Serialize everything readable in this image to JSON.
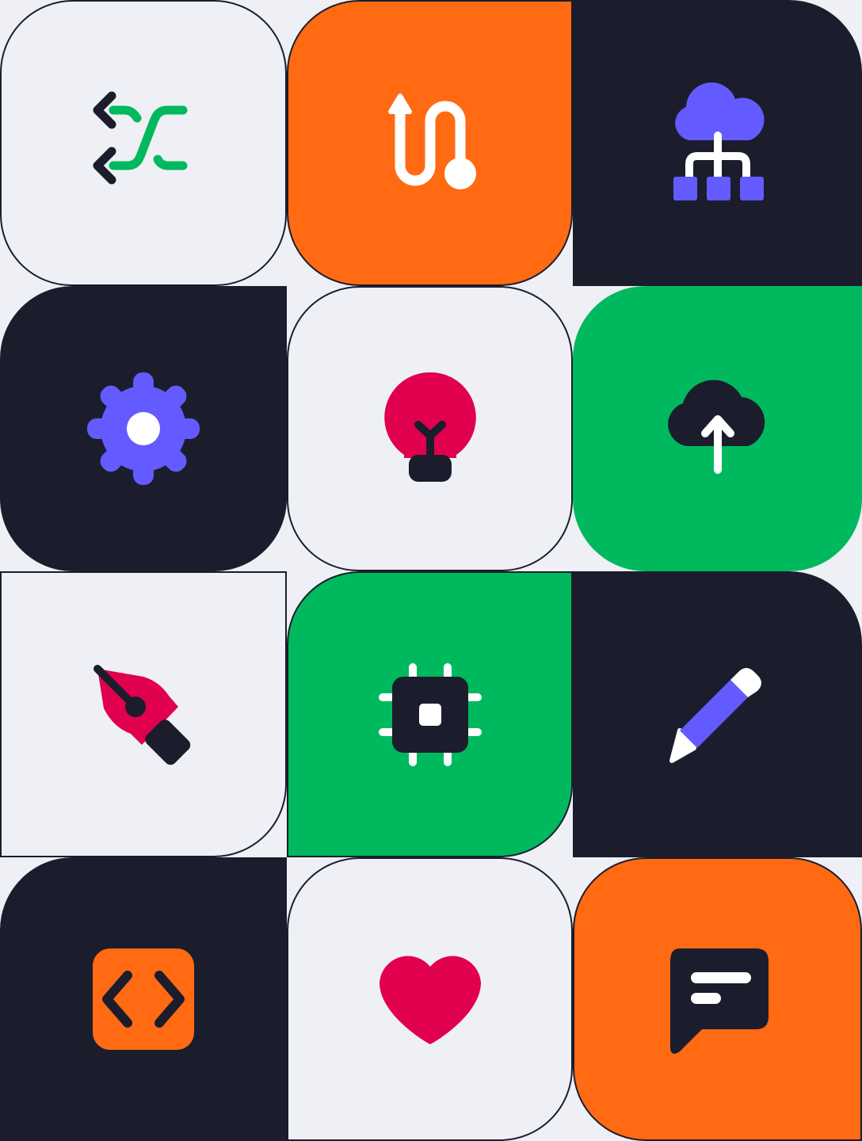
{
  "colors": {
    "background": "#eef0f5",
    "light": "#eef0f5",
    "dark": "#1b1d2c",
    "orange": "#ff6a13",
    "green": "#00b95f",
    "purple": "#635bff",
    "red": "#e0004d",
    "white": "#ffffff"
  },
  "tiles": [
    {
      "icon": "shuffle-arrows-icon",
      "background": "light"
    },
    {
      "icon": "route-path-icon",
      "background": "orange"
    },
    {
      "icon": "cloud-network-icon",
      "background": "dark"
    },
    {
      "icon": "gear-icon",
      "background": "dark"
    },
    {
      "icon": "lightbulb-icon",
      "background": "light"
    },
    {
      "icon": "cloud-upload-icon",
      "background": "green"
    },
    {
      "icon": "pen-nib-icon",
      "background": "light"
    },
    {
      "icon": "cpu-chip-icon",
      "background": "green"
    },
    {
      "icon": "pencil-icon",
      "background": "dark"
    },
    {
      "icon": "code-brackets-icon",
      "background": "dark"
    },
    {
      "icon": "heart-icon",
      "background": "light"
    },
    {
      "icon": "chat-message-icon",
      "background": "orange"
    }
  ]
}
